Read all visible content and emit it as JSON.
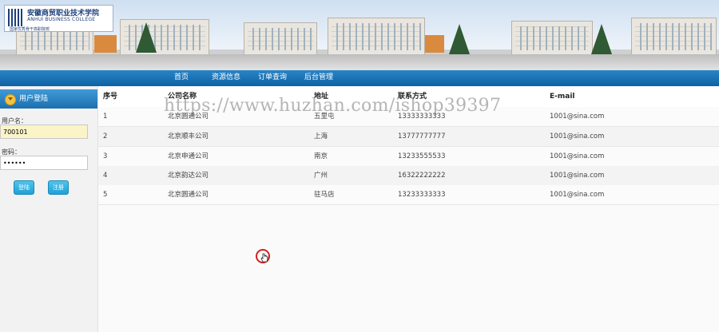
{
  "banner": {
    "logo_cn": "安徽商贸职业技术学院",
    "logo_en": "ANHUI BUSINESS COLLEGE",
    "logo_tag": "国家优秀骨干高职院校"
  },
  "nav": {
    "items": [
      {
        "label": "首页"
      },
      {
        "label": "资源信息"
      },
      {
        "label": "订单查询"
      },
      {
        "label": "后台管理"
      }
    ]
  },
  "sidebar": {
    "title": "用户登陆",
    "username_label": "用户名：",
    "username_value": "700101",
    "password_label": "密码：",
    "password_value": "••••••",
    "login_label": "登陆",
    "register_label": "注册"
  },
  "table": {
    "headers": [
      "序号",
      "公司名称",
      "地址",
      "联系方式",
      "E-mail"
    ],
    "rows": [
      [
        "1",
        "北京圆通公司",
        "五里屯",
        "13333333333",
        "1001@sina.com"
      ],
      [
        "2",
        "北京顺丰公司",
        "上海",
        "13777777777",
        "1001@sina.com"
      ],
      [
        "3",
        "北京申通公司",
        "南京",
        "13233555533",
        "1001@sina.com"
      ],
      [
        "4",
        "北京韵达公司",
        "广州",
        "16322222222",
        "1001@sina.com"
      ],
      [
        "5",
        "北京圆通公司",
        "驻马店",
        "13233333333",
        "1001@sina.com"
      ]
    ]
  },
  "watermark": "https://www.huzhan.com/ishop39397",
  "colors": {
    "nav_bg": "#1a72b6",
    "sidebar_header": "#2a83c4",
    "button": "#2ab0e2",
    "username_bg": "#fbf4c8"
  }
}
